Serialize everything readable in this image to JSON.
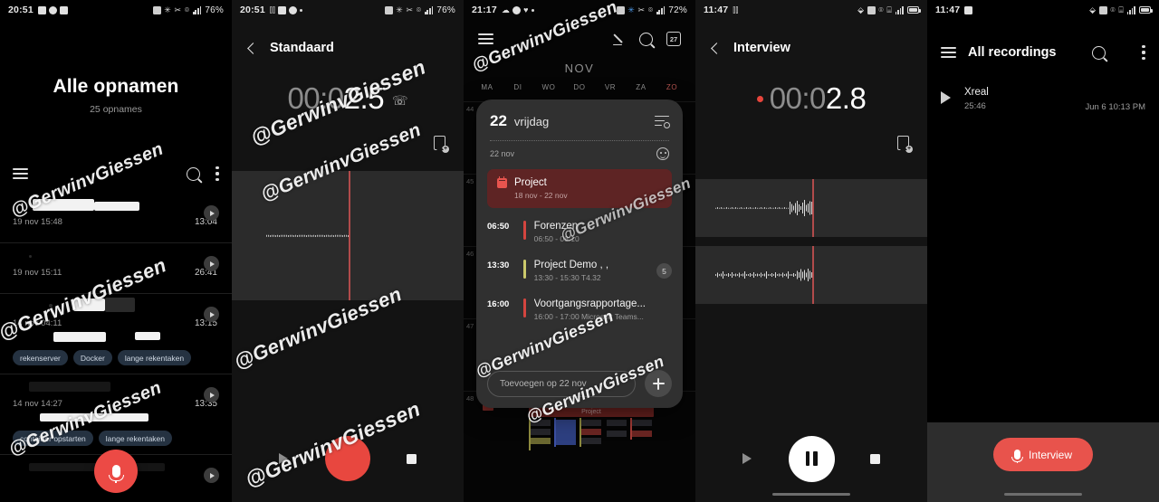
{
  "watermark": "@GerwinvGiessen",
  "panel1": {
    "statusbar": {
      "time": "20:51",
      "battery": "76%"
    },
    "title": "Alle opnamen",
    "subtitle": "25 opnames",
    "icons": {
      "menu": "hamburger-icon",
      "search": "search-icon",
      "more": "kebab-menu-icon"
    },
    "recordings": [
      {
        "date": "19 nov 15:48",
        "duration": "13:04",
        "tags": []
      },
      {
        "date": "19 nov 15:11",
        "duration": "26:41",
        "tags": []
      },
      {
        "date": "14 nov 04:11",
        "duration": "13:15",
        "tags": [
          "rekenserver",
          "Docker",
          "lange rekentaken"
        ]
      },
      {
        "date": "14 nov 14:27",
        "duration": "13:35",
        "tags": [
          "container opstarten",
          "lange rekentaken"
        ]
      }
    ],
    "fab": "record-mic-button"
  },
  "panel2": {
    "statusbar": {
      "time": "20:51",
      "battery": "76%"
    },
    "nav": {
      "back": "back-arrow-icon",
      "title": "Standaard"
    },
    "timer": {
      "dim": "00:0",
      "lit": "2.5"
    },
    "controls": {
      "play": "play-button",
      "record": "record-button",
      "stop": "stop-button"
    },
    "bookmark": "add-bookmark-icon"
  },
  "panel3": {
    "statusbar": {
      "time": "21:17",
      "battery": "72%"
    },
    "toolbar": {
      "menu": "hamburger-icon",
      "edit": "pencil-icon",
      "search": "search-icon",
      "today": "27"
    },
    "month": "NOV",
    "weekdays": [
      "MA",
      "DI",
      "WO",
      "DO",
      "VR",
      "ZA",
      "ZO"
    ],
    "weeknumbers": [
      "44",
      "45",
      "46",
      "47",
      "48"
    ],
    "sheet": {
      "daynum": "22",
      "dayname": "vrijdag",
      "subdate": "22 nov",
      "allday": {
        "name": "Project",
        "range": "18 nov - 22 nov"
      },
      "events": [
        {
          "time": "06:50",
          "name": "Forenzen",
          "sub": "06:50 - 08:10",
          "color": "#d4453f",
          "badge": ""
        },
        {
          "time": "13:30",
          "name": "Project Demo , ,",
          "sub": "13:30 - 15:30  T4.32",
          "color": "#cbc96b",
          "badge": "5"
        },
        {
          "time": "16:00",
          "name": "Voortgangsrapportage...",
          "sub": "16:00 - 17:00  Microsoft Teams...",
          "color": "#d4453f",
          "badge": ""
        }
      ],
      "add_placeholder": "Toevoegen op 22 nov",
      "add_button": "add-event-button"
    },
    "bg_event_label": "Project"
  },
  "panel4": {
    "statusbar": {
      "time": "11:47",
      "battery": ""
    },
    "nav": {
      "back": "back-arrow-icon",
      "title": "Interview"
    },
    "timer": {
      "dim": "00:0",
      "lit": "2.8"
    },
    "recording_dot": true,
    "controls": {
      "play": "play-button",
      "pause": "pause-button",
      "stop": "stop-button"
    },
    "bookmark": "add-bookmark-icon"
  },
  "panel5": {
    "statusbar": {
      "time": "11:47",
      "battery": ""
    },
    "toolbar": {
      "menu": "hamburger-icon",
      "title": "All recordings",
      "search": "search-icon",
      "more": "kebab-menu-icon"
    },
    "recordings": [
      {
        "name": "Xreal",
        "duration": "25:46",
        "date": "Jun 6 10:13 PM"
      }
    ],
    "cta": {
      "label": "Interview",
      "icon": "mic-icon",
      "color": "#e8534c"
    }
  }
}
